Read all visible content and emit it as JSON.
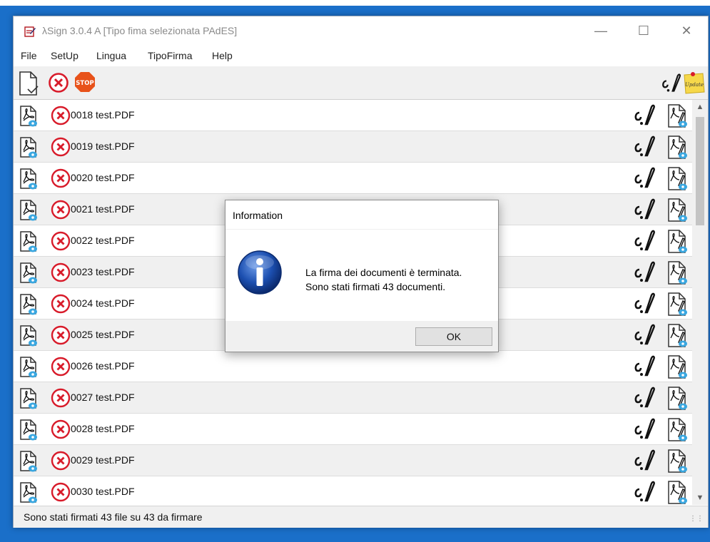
{
  "window": {
    "title": "λSign  3.0.4 A  [Tipo fima selezionata PAdES]",
    "minimize": "—",
    "maximize": "☐",
    "close": "✕"
  },
  "menu": [
    "File",
    "SetUp",
    "Lingua",
    "TipoFirma",
    "Help"
  ],
  "toolbar": {
    "stop_label": "STOP",
    "update_label": "Update"
  },
  "files": [
    "0018 test.PDF",
    "0019 test.PDF",
    "0020 test.PDF",
    "0021 test.PDF",
    "0022 test.PDF",
    "0023 test.PDF",
    "0024 test.PDF",
    "0025 test.PDF",
    "0026 test.PDF",
    "0027 test.PDF",
    "0028 test.PDF",
    "0029 test.PDF",
    "0030 test.PDF"
  ],
  "status": {
    "text": "Sono stati firmati 43 file su 43 da firmare"
  },
  "dialog": {
    "title": "Information",
    "message_line1": "La firma dei documenti è terminata.",
    "message_line2": "Sono stati firmati 43 documenti.",
    "ok_label": "OK"
  },
  "colors": {
    "accent_red": "#d81b2a",
    "stop_red": "#e8521a",
    "info_blue": "#1c4fb0",
    "pdf_badge_blue": "#3aa7e0"
  }
}
